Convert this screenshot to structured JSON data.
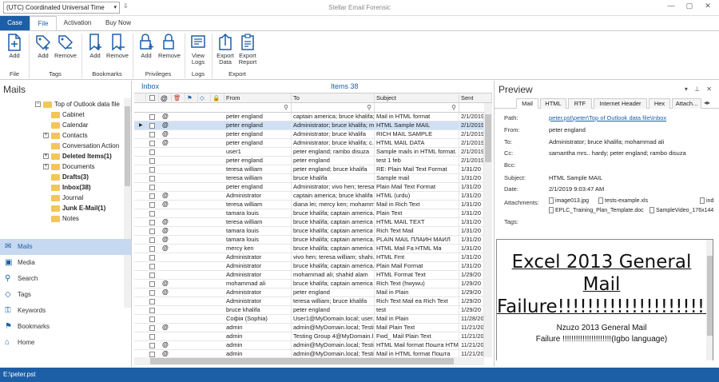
{
  "titlebar": {
    "timezone": "(UTC) Coordinated Universal Time",
    "app_title": "Stellar Email Forensic"
  },
  "menu": {
    "case": "Case",
    "file": "File",
    "activation": "Activation",
    "buy_now": "Buy Now"
  },
  "ribbon": {
    "file_add": "Add",
    "tags_add": "Add",
    "tags_remove": "Remove",
    "bookmarks_add": "Add",
    "bookmarks_remove": "Remove",
    "priv_add": "Add",
    "priv_remove": "Remove",
    "view_logs": "View\nLogs",
    "export_data": "Export\nData",
    "export_report": "Export\nReport",
    "groups": {
      "file": "File",
      "tags": "Tags",
      "bookmarks": "Bookmarks",
      "privileges": "Privileges",
      "logs": "Logs",
      "export": "Export"
    }
  },
  "left": {
    "title": "Mails",
    "tree": [
      {
        "label": "Top of Outlook data file",
        "bold": false,
        "expander": "−"
      },
      {
        "label": "Cabinet",
        "bold": false,
        "expander": ""
      },
      {
        "label": "Calendar",
        "bold": false,
        "expander": ""
      },
      {
        "label": "Contacts",
        "bold": false,
        "expander": "+"
      },
      {
        "label": "Conversation Action",
        "bold": false,
        "expander": ""
      },
      {
        "label": "Deleted Items(1)",
        "bold": true,
        "expander": "+"
      },
      {
        "label": "Documents",
        "bold": false,
        "expander": "+"
      },
      {
        "label": "Drafts(3)",
        "bold": true,
        "expander": ""
      },
      {
        "label": "Inbox(38)",
        "bold": true,
        "expander": ""
      },
      {
        "label": "Journal",
        "bold": false,
        "expander": ""
      },
      {
        "label": "Junk E-Mail(1)",
        "bold": true,
        "expander": ""
      },
      {
        "label": "Notes",
        "bold": false,
        "expander": ""
      }
    ],
    "nav": [
      "Mails",
      "Media",
      "Search",
      "Tags",
      "Keywords",
      "Bookmarks",
      "Home"
    ]
  },
  "grid": {
    "folder": "Inbox",
    "items_label": "Items 38",
    "columns": {
      "from": "From",
      "to": "To",
      "subject": "Subject",
      "sent": "Sent"
    },
    "rows": [
      {
        "att": true,
        "from": "peter england",
        "to": "captain america; bruce khalifa; m...",
        "subject": "Mail in HTML format",
        "sent": "2/1/2019",
        "sel": false
      },
      {
        "att": true,
        "from": "peter england",
        "to": "Administrator; bruce khalifa; m...",
        "subject": "HTML Sample MAIL",
        "sent": "2/1/2019",
        "sel": true
      },
      {
        "att": true,
        "from": "peter england",
        "to": "Administrator; bruce khalifa",
        "subject": "RICH MAIL SAMPLE",
        "sent": "2/1/2019",
        "sel": false
      },
      {
        "att": true,
        "from": "peter england",
        "to": "Administrator; bruce khalifa; c...",
        "subject": "HTML MAIL DATA",
        "sent": "2/1/2019",
        "sel": false
      },
      {
        "att": false,
        "from": "user1",
        "to": "peter england; rambo disuza",
        "subject": "Sample mails in HTML format.",
        "sent": "2/1/2019",
        "sel": false
      },
      {
        "att": false,
        "from": "peter england",
        "to": "peter england",
        "subject": "test 1 feb",
        "sent": "2/1/2019",
        "sel": false
      },
      {
        "att": false,
        "from": "teresa william",
        "to": "peter england; bruce khalifa",
        "subject": "RE: Plain Mail Text Format",
        "sent": "1/31/20",
        "sel": false
      },
      {
        "att": false,
        "from": "teresa william",
        "to": "bruce khalifa",
        "subject": "Sample mail",
        "sent": "1/31/20",
        "sel": false
      },
      {
        "att": false,
        "from": "peter england",
        "to": "Administrator; vivo hen; teresa...",
        "subject": "Plain Mail Text Format",
        "sent": "1/31/20",
        "sel": false
      },
      {
        "att": true,
        "from": "Administrator",
        "to": "captain america; bruce khalifa",
        "subject": "HTML (urdu)",
        "sent": "1/31/20",
        "sel": false
      },
      {
        "att": true,
        "from": "teresa william",
        "to": "diana lei; mercy ken; mohamm...",
        "subject": "Mail in Rich Text",
        "sent": "1/31/20",
        "sel": false
      },
      {
        "att": false,
        "from": "tamara louis",
        "to": "bruce khalifa; captain america...",
        "subject": "Plain Text",
        "sent": "1/31/20",
        "sel": false
      },
      {
        "att": true,
        "from": "teresa william",
        "to": "bruce khalifa; captain america",
        "subject": "HTML MAIL TEXT",
        "sent": "1/31/20",
        "sel": false
      },
      {
        "att": true,
        "from": "tamara louis",
        "to": "bruce khalifa; captain america",
        "subject": "Rich Text Mail",
        "sent": "1/31/20",
        "sel": false
      },
      {
        "att": true,
        "from": "tamara louis",
        "to": "bruce khalifa; captain america...",
        "subject": "PLAIN MAIL ПЛАИН МАИЛ",
        "sent": "1/31/20",
        "sel": false
      },
      {
        "att": true,
        "from": "mercy ken",
        "to": "bruce khalifa; captain america",
        "subject": "HTML Mail Fa HTML Ma",
        "sent": "1/31/20",
        "sel": false
      },
      {
        "att": false,
        "from": "Administrator",
        "to": "vivo hen; teresa william; shahi...",
        "subject": "HTML Fmt",
        "sent": "1/31/20",
        "sel": false
      },
      {
        "att": false,
        "from": "Administrator",
        "to": "bruce khalifa; captain america...",
        "subject": "Plain Mail Format",
        "sent": "1/31/20",
        "sel": false
      },
      {
        "att": false,
        "from": "Administrator",
        "to": "mohammad ali; shahid alam",
        "subject": "HTML Format Text",
        "sent": "1/29/20",
        "sel": false
      },
      {
        "att": true,
        "from": "mohammad ali",
        "to": "bruce khalifa; captain america",
        "subject": "Rich Text (hwywu)",
        "sent": "1/29/20",
        "sel": false
      },
      {
        "att": true,
        "from": "Administrator",
        "to": "peter england",
        "subject": "Mail in Plain",
        "sent": "1/29/20",
        "sel": false
      },
      {
        "att": false,
        "from": "Administrator",
        "to": "teresa william; bruce khalifa",
        "subject": "Rich Text Mail ea Rich Text",
        "sent": "1/29/20",
        "sel": false
      },
      {
        "att": false,
        "from": "bruce khalifa",
        "to": "peter england",
        "subject": "test",
        "sent": "1/29/20",
        "sel": false
      },
      {
        "att": false,
        "from": "Софія (Sophia)",
        "to": "User1@MyDomain.local; user...",
        "subject": "Mail in Plain",
        "sent": "11/28/20",
        "sel": false
      },
      {
        "att": true,
        "from": "admin",
        "to": "admin@MyDomain.local; Testi...",
        "subject": "Mail Plain Text",
        "sent": "11/21/20",
        "sel": false
      },
      {
        "att": false,
        "from": "admin",
        "to": "Testing Group 4@MyDomain.l...",
        "subject": "Fwd_ Mail Plain Text",
        "sent": "11/21/20",
        "sel": false
      },
      {
        "att": true,
        "from": "admin",
        "to": "admin@MyDomain.local; Testi...",
        "subject": "HTML Mail format Пошта HTML",
        "sent": "11/21/20",
        "sel": false
      },
      {
        "att": true,
        "from": "admin",
        "to": "admin@MyDomain.local; Testi...",
        "subject": "Mail in HTML format Пошта",
        "sent": "11/21/20",
        "sel": false
      }
    ]
  },
  "preview": {
    "title": "Preview",
    "tabs": [
      "Mail",
      "HTML",
      "RTF",
      "Internet Header",
      "Hex",
      "Attach..."
    ],
    "labels": {
      "path": "Path:",
      "from": "From:",
      "to": "To:",
      "cc": "Cc:",
      "bcc": "Bcc:",
      "subject": "Subject:",
      "date": "Date:",
      "attachments": "Attachments:",
      "tags": "Tags:"
    },
    "path": "peter.pst\\peter\\Top of Outlook data file\\Inbox",
    "from": "peter england",
    "to": "Administrator; bruce khalifa; mohammad ali",
    "cc": "samantha mrs.. hardy; peter england; rambo disuza",
    "bcc": "",
    "subject": "HTML Sample MAIL",
    "date": "2/1/2019 9:03:47 AM",
    "attachments": [
      "image013.jpg",
      "tests-example.xls",
      "ind",
      "EPLC_Training_Plan_Template.doc",
      "SampleVideo_176x144"
    ],
    "tags": "",
    "body_heading": "Excel 2013 General Mail Failure!!!!!!!!!!!!!!!!!!!!!",
    "body_line1": "Nzuzo 2013 General Mail",
    "body_line2": "Failure !!!!!!!!!!!!!!!!!!!!!!(Igbo language)"
  },
  "status": "E:\\peter.pst",
  "colors": {
    "accent": "#1d5fa6",
    "selected": "#cfe0f5",
    "nav_active": "#c7d9f1",
    "folder": "#f3c65b"
  }
}
